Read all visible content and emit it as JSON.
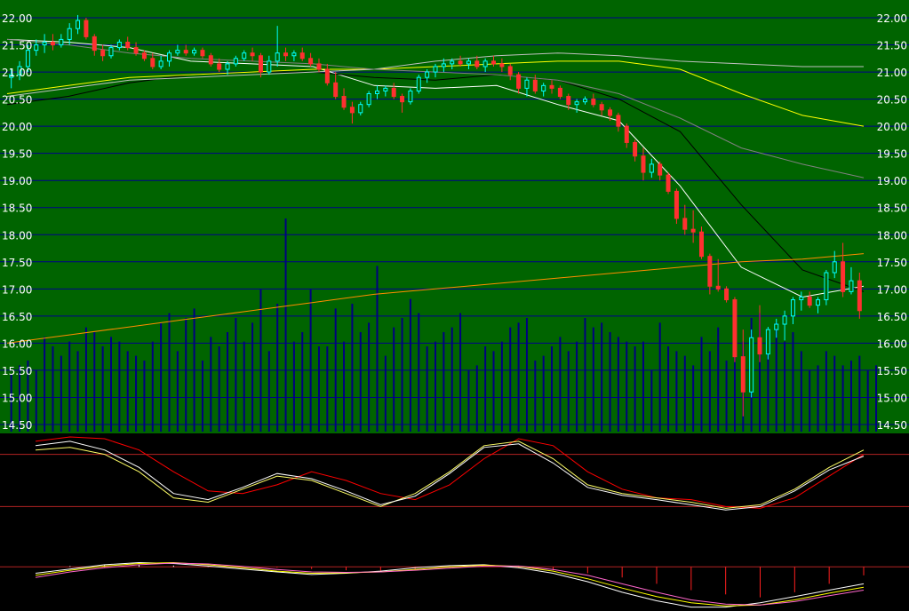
{
  "chart_data": [
    {
      "type": "candlestick",
      "panel": "price",
      "y_ticks": [
        "22.00",
        "21.50",
        "21.00",
        "20.50",
        "20.00",
        "19.50",
        "19.00",
        "18.50",
        "18.00",
        "17.50",
        "17.00",
        "16.50",
        "16.00",
        "15.50",
        "15.00",
        "14.50"
      ],
      "y_tick_values": [
        22.0,
        21.5,
        21.0,
        20.5,
        20.0,
        19.5,
        19.0,
        18.5,
        18.0,
        17.5,
        17.0,
        16.5,
        16.0,
        15.5,
        15.0,
        14.5
      ],
      "ylim": [
        14.5,
        22.0
      ],
      "background": "#006400",
      "grid": true,
      "candles": [
        [
          20.9,
          21.05,
          20.7,
          20.95
        ],
        [
          20.95,
          21.2,
          20.85,
          21.1
        ],
        [
          21.1,
          21.5,
          21.0,
          21.4
        ],
        [
          21.4,
          21.6,
          21.3,
          21.5
        ],
        [
          21.5,
          21.7,
          21.35,
          21.55
        ],
        [
          21.55,
          21.7,
          21.4,
          21.5
        ],
        [
          21.5,
          21.7,
          21.45,
          21.6
        ],
        [
          21.6,
          21.9,
          21.5,
          21.8
        ],
        [
          21.8,
          22.05,
          21.7,
          21.95
        ],
        [
          21.95,
          22.0,
          21.6,
          21.65
        ],
        [
          21.65,
          21.7,
          21.3,
          21.4
        ],
        [
          21.4,
          21.5,
          21.2,
          21.3
        ],
        [
          21.3,
          21.5,
          21.25,
          21.45
        ],
        [
          21.45,
          21.6,
          21.4,
          21.55
        ],
        [
          21.55,
          21.65,
          21.4,
          21.45
        ],
        [
          21.45,
          21.55,
          21.3,
          21.35
        ],
        [
          21.35,
          21.4,
          21.2,
          21.25
        ],
        [
          21.25,
          21.35,
          21.05,
          21.1
        ],
        [
          21.1,
          21.3,
          21.05,
          21.2
        ],
        [
          21.2,
          21.4,
          21.1,
          21.35
        ],
        [
          21.35,
          21.5,
          21.3,
          21.4
        ],
        [
          21.4,
          21.5,
          21.3,
          21.35
        ],
        [
          21.35,
          21.45,
          21.3,
          21.4
        ],
        [
          21.4,
          21.45,
          21.25,
          21.3
        ],
        [
          21.3,
          21.35,
          21.1,
          21.15
        ],
        [
          21.15,
          21.25,
          21.0,
          21.05
        ],
        [
          21.05,
          21.2,
          20.95,
          21.15
        ],
        [
          21.15,
          21.3,
          21.1,
          21.25
        ],
        [
          21.25,
          21.4,
          21.2,
          21.35
        ],
        [
          21.35,
          21.45,
          21.2,
          21.3
        ],
        [
          21.3,
          21.35,
          20.9,
          21.0
        ],
        [
          21.0,
          21.3,
          20.95,
          21.2
        ],
        [
          21.2,
          21.85,
          21.1,
          21.35
        ],
        [
          21.35,
          21.45,
          21.2,
          21.3
        ],
        [
          21.3,
          21.4,
          21.2,
          21.35
        ],
        [
          21.35,
          21.45,
          21.2,
          21.25
        ],
        [
          21.25,
          21.35,
          21.1,
          21.15
        ],
        [
          21.15,
          21.25,
          21.0,
          21.05
        ],
        [
          21.05,
          21.15,
          20.75,
          20.8
        ],
        [
          20.8,
          21.0,
          20.5,
          20.55
        ],
        [
          20.55,
          20.7,
          20.3,
          20.35
        ],
        [
          20.35,
          20.45,
          20.05,
          20.25
        ],
        [
          20.25,
          20.45,
          20.2,
          20.4
        ],
        [
          20.4,
          20.65,
          20.35,
          20.6
        ],
        [
          20.6,
          20.75,
          20.5,
          20.65
        ],
        [
          20.65,
          20.75,
          20.55,
          20.7
        ],
        [
          20.7,
          20.8,
          20.5,
          20.55
        ],
        [
          20.55,
          20.6,
          20.25,
          20.45
        ],
        [
          20.45,
          20.7,
          20.4,
          20.65
        ],
        [
          20.65,
          20.95,
          20.6,
          20.9
        ],
        [
          20.9,
          21.05,
          20.8,
          21.0
        ],
        [
          21.0,
          21.15,
          20.9,
          21.1
        ],
        [
          21.1,
          21.25,
          21.0,
          21.15
        ],
        [
          21.15,
          21.25,
          21.05,
          21.2
        ],
        [
          21.2,
          21.3,
          21.1,
          21.15
        ],
        [
          21.15,
          21.25,
          21.05,
          21.2
        ],
        [
          21.2,
          21.3,
          21.05,
          21.1
        ],
        [
          21.1,
          21.25,
          21.0,
          21.2
        ],
        [
          21.2,
          21.3,
          21.1,
          21.15
        ],
        [
          21.15,
          21.25,
          21.0,
          21.1
        ],
        [
          21.1,
          21.15,
          20.85,
          20.95
        ],
        [
          20.95,
          21.0,
          20.6,
          20.7
        ],
        [
          20.7,
          20.9,
          20.55,
          20.85
        ],
        [
          20.85,
          20.95,
          20.6,
          20.65
        ],
        [
          20.65,
          20.8,
          20.55,
          20.75
        ],
        [
          20.75,
          20.85,
          20.6,
          20.7
        ],
        [
          20.7,
          20.75,
          20.5,
          20.55
        ],
        [
          20.55,
          20.6,
          20.3,
          20.4
        ],
        [
          20.4,
          20.5,
          20.25,
          20.45
        ],
        [
          20.45,
          20.55,
          20.4,
          20.5
        ],
        [
          20.5,
          20.6,
          20.35,
          20.4
        ],
        [
          20.4,
          20.45,
          20.2,
          20.3
        ],
        [
          20.3,
          20.35,
          20.1,
          20.2
        ],
        [
          20.2,
          20.25,
          19.9,
          20.0
        ],
        [
          20.0,
          20.05,
          19.6,
          19.7
        ],
        [
          19.7,
          19.75,
          19.35,
          19.45
        ],
        [
          19.45,
          19.6,
          19.0,
          19.15
        ],
        [
          19.15,
          19.4,
          19.05,
          19.3
        ],
        [
          19.3,
          19.35,
          19.0,
          19.1
        ],
        [
          19.1,
          19.15,
          18.75,
          18.8
        ],
        [
          18.8,
          18.85,
          18.2,
          18.3
        ],
        [
          18.3,
          18.55,
          18.0,
          18.1
        ],
        [
          18.1,
          18.45,
          17.85,
          18.05
        ],
        [
          18.05,
          18.15,
          17.55,
          17.6
        ],
        [
          17.6,
          17.65,
          16.9,
          17.05
        ],
        [
          17.05,
          17.55,
          16.95,
          17.0
        ],
        [
          17.0,
          17.05,
          16.75,
          16.8
        ],
        [
          16.8,
          16.85,
          15.65,
          15.75
        ],
        [
          15.75,
          16.25,
          14.65,
          15.1
        ],
        [
          15.1,
          16.25,
          15.0,
          16.1
        ],
        [
          16.1,
          16.7,
          15.65,
          15.8
        ],
        [
          15.8,
          16.3,
          15.7,
          16.25
        ],
        [
          16.25,
          16.45,
          16.1,
          16.35
        ],
        [
          16.35,
          16.6,
          16.05,
          16.5
        ],
        [
          16.5,
          16.85,
          16.35,
          16.8
        ],
        [
          16.8,
          16.95,
          16.6,
          16.85
        ],
        [
          16.85,
          16.95,
          16.65,
          16.7
        ],
        [
          16.7,
          16.85,
          16.55,
          16.8
        ],
        [
          16.8,
          17.35,
          16.7,
          17.3
        ],
        [
          17.3,
          17.7,
          17.2,
          17.5
        ],
        [
          17.5,
          17.85,
          16.85,
          16.95
        ],
        [
          16.95,
          17.4,
          16.9,
          17.15
        ],
        [
          17.15,
          17.3,
          16.45,
          16.6
        ]
      ],
      "volume": [
        12,
        14,
        15,
        13,
        20,
        18,
        16,
        19,
        17,
        22,
        21,
        18,
        20,
        19,
        17,
        16,
        15,
        19,
        23,
        25,
        17,
        24,
        26,
        15,
        20,
        18,
        21,
        24,
        19,
        23,
        30,
        17,
        27,
        45,
        19,
        21,
        30,
        18,
        18,
        26,
        19,
        27,
        21,
        23,
        35,
        16,
        22,
        24,
        28,
        25,
        18,
        19,
        21,
        22,
        25,
        13,
        14,
        18,
        17,
        19,
        22,
        23,
        24,
        15,
        16,
        18,
        20,
        17,
        19,
        24,
        22,
        23,
        21,
        20,
        19,
        18,
        19,
        13,
        23,
        18,
        17,
        16,
        14,
        20,
        17,
        22,
        15,
        17,
        19,
        24,
        25,
        17,
        23,
        19,
        21,
        17,
        13,
        14,
        17,
        16,
        14,
        15,
        16,
        13,
        14
      ],
      "moving_averages": [
        {
          "color": "#ffffff",
          "values": [
            21.6,
            21.55,
            21.45,
            21.2,
            21.15,
            21.1,
            20.75,
            20.7,
            20.75,
            20.4,
            20.1,
            18.9,
            17.4,
            16.85,
            17.05
          ]
        },
        {
          "color": "#000000",
          "values": [
            20.4,
            20.55,
            20.8,
            20.95,
            21.0,
            21.0,
            20.9,
            20.85,
            20.95,
            20.85,
            20.5,
            19.9,
            18.55,
            17.35,
            16.95
          ]
        },
        {
          "color": "#ffff00",
          "values": [
            20.6,
            20.75,
            20.9,
            20.95,
            21.0,
            21.05,
            21.05,
            21.1,
            21.15,
            21.2,
            21.2,
            21.05,
            20.6,
            20.2,
            20.0
          ]
        },
        {
          "color": "#c0c0c0",
          "values": [
            20.55,
            20.7,
            20.85,
            20.9,
            20.95,
            21.0,
            21.05,
            21.2,
            21.3,
            21.35,
            21.3,
            21.2,
            21.15,
            21.1,
            21.1
          ]
        },
        {
          "color": "#ff8c00",
          "values": [
            16.0,
            16.15,
            16.3,
            16.45,
            16.6,
            16.75,
            16.9,
            17.0,
            17.1,
            17.2,
            17.3,
            17.4,
            17.5,
            17.55,
            17.65
          ]
        },
        {
          "color": "#808080",
          "values": [
            21.6,
            21.5,
            21.35,
            21.25,
            21.2,
            21.15,
            21.05,
            21.0,
            20.95,
            20.85,
            20.6,
            20.15,
            19.6,
            19.3,
            19.05
          ]
        }
      ]
    },
    {
      "type": "line",
      "panel": "oscillator",
      "levels": [
        80,
        20
      ],
      "ylim": [
        0,
        100
      ],
      "series": [
        {
          "color": "#ff0000",
          "values": [
            95,
            100,
            98,
            85,
            60,
            38,
            35,
            45,
            60,
            50,
            35,
            28,
            45,
            75,
            98,
            90,
            60,
            40,
            30,
            28,
            20,
            18,
            30,
            55,
            80
          ]
        },
        {
          "color": "#ffff66",
          "values": [
            85,
            88,
            80,
            60,
            30,
            25,
            40,
            55,
            50,
            35,
            20,
            35,
            60,
            90,
            95,
            75,
            45,
            35,
            30,
            25,
            18,
            22,
            40,
            65,
            85
          ]
        },
        {
          "color": "#ffffff",
          "values": [
            90,
            95,
            85,
            65,
            35,
            28,
            42,
            58,
            52,
            38,
            22,
            32,
            58,
            88,
            92,
            70,
            42,
            33,
            28,
            22,
            16,
            20,
            38,
            62,
            78
          ]
        }
      ]
    },
    {
      "type": "line",
      "panel": "macd",
      "ylim": [
        -100,
        30
      ],
      "histogram": [
        0,
        2,
        4,
        5,
        3,
        1,
        0,
        -2,
        -5,
        -8,
        -10,
        -6,
        -2,
        0,
        -3,
        -8,
        -15,
        -25,
        -40,
        -55,
        -65,
        -72,
        -60,
        -40,
        -20
      ],
      "series": [
        {
          "color": "#ffffff",
          "values": [
            -15,
            -5,
            5,
            10,
            8,
            2,
            -5,
            -12,
            -18,
            -15,
            -10,
            -2,
            3,
            5,
            -2,
            -15,
            -35,
            -60,
            -80,
            -95,
            -95,
            -85,
            -70,
            -55,
            -40
          ]
        },
        {
          "color": "#ffff00",
          "values": [
            -20,
            -8,
            2,
            8,
            10,
            5,
            -2,
            -10,
            -15,
            -14,
            -12,
            -6,
            0,
            4,
            1,
            -10,
            -28,
            -50,
            -70,
            -85,
            -92,
            -90,
            -78,
            -62,
            -48
          ]
        },
        {
          "color": "#ff66cc",
          "values": [
            -25,
            -12,
            -2,
            5,
            9,
            7,
            1,
            -6,
            -12,
            -13,
            -12,
            -8,
            -3,
            2,
            2,
            -6,
            -20,
            -40,
            -60,
            -78,
            -88,
            -90,
            -82,
            -68,
            -55
          ]
        }
      ]
    }
  ]
}
